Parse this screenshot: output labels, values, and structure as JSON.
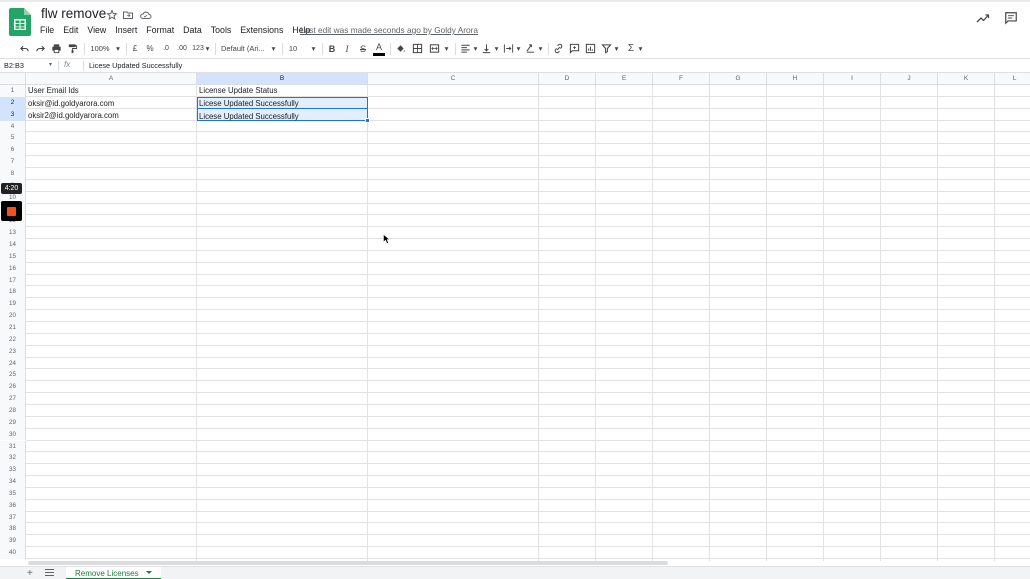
{
  "header": {
    "doc_title": "flw remove",
    "last_edit": "Last edit was made seconds ago by Goldy Arora",
    "menu": [
      "File",
      "Edit",
      "View",
      "Insert",
      "Format",
      "Data",
      "Tools",
      "Extensions",
      "Help"
    ],
    "icons": [
      "star-icon",
      "move-to-folder-icon",
      "cloud-status-icon",
      "activity-trend-icon",
      "comments-icon"
    ]
  },
  "toolbar": {
    "zoom": "100%",
    "currency": "£",
    "percent": "%",
    "dec_decrease": ".0",
    "dec_increase": ".00",
    "more_formats": "123",
    "font": "Default (Ari...",
    "font_size": "10",
    "bold": "B",
    "italic": "I",
    "strike": "S",
    "text_color": "A",
    "function": "Σ"
  },
  "formula_bar": {
    "name_box": "B2:B3",
    "fx": "fx",
    "value": "Licese Updated Successfully"
  },
  "grid": {
    "columns": [
      "A",
      "B",
      "C",
      "D",
      "E",
      "F",
      "G",
      "H",
      "I",
      "J",
      "K",
      "L"
    ],
    "rows": [
      "1",
      "2",
      "3",
      "4",
      "5",
      "6",
      "7",
      "8",
      "9",
      "10",
      "11",
      "12",
      "13",
      "14",
      "15",
      "16",
      "17",
      "18",
      "19",
      "20",
      "21",
      "22",
      "23",
      "24",
      "25",
      "26",
      "27",
      "28",
      "29",
      "30",
      "31",
      "32",
      "33",
      "34",
      "35",
      "36",
      "37",
      "38",
      "39",
      "40"
    ],
    "cells": {
      "A1": "User Email Ids",
      "B1": "License Update Status",
      "A2": "oksir@id.goldyarora.com",
      "B2": "Licese Updated Successfully",
      "A3": "oksir2@id.goldyarora.com",
      "B3": "Licese Updated Successfully"
    },
    "selection": "B2:B3"
  },
  "recorder": {
    "timer": "4:20"
  },
  "sheets": {
    "add": "+",
    "active_tab": "Remove Licenses"
  },
  "colors": {
    "brand_green": "#188038",
    "selection_blue": "#1a73e8",
    "recorder_stop": "#f4511e"
  }
}
